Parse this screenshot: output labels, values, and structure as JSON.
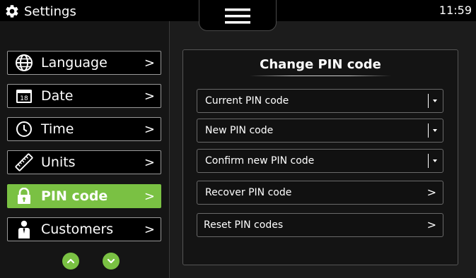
{
  "header": {
    "title": "Settings",
    "title_icon": "gear-icon",
    "menu_icon": "hamburger-menu-icon",
    "time": "11:59"
  },
  "sidebar": {
    "items": [
      {
        "label": "Language",
        "icon": "globe-icon",
        "active": false
      },
      {
        "label": "Date",
        "icon": "calendar-icon",
        "icon_text": "18",
        "active": false
      },
      {
        "label": "Time",
        "icon": "clock-icon",
        "active": false
      },
      {
        "label": "Units",
        "icon": "ruler-icon",
        "active": false
      },
      {
        "label": "PIN code",
        "icon": "lock-icon",
        "active": true
      },
      {
        "label": "Customers",
        "icon": "person-icon",
        "active": false
      }
    ],
    "chevron": ">",
    "scroll_up_icon": "chevron-up-icon",
    "scroll_down_icon": "chevron-down-icon"
  },
  "content": {
    "title": "Change PIN code",
    "rows": [
      {
        "label": "Current PIN code",
        "type": "dropdown"
      },
      {
        "label": "New PIN code",
        "type": "dropdown"
      },
      {
        "label": "Confirm new PIN code",
        "type": "dropdown"
      },
      {
        "label": "Recover PIN code",
        "type": "link",
        "chevron": ">"
      },
      {
        "label": "Reset PIN codes",
        "type": "link",
        "chevron": ">"
      }
    ]
  },
  "colors": {
    "accent": "#7ac143",
    "background": "#1c1c1c",
    "border": "#9a9a9a"
  }
}
